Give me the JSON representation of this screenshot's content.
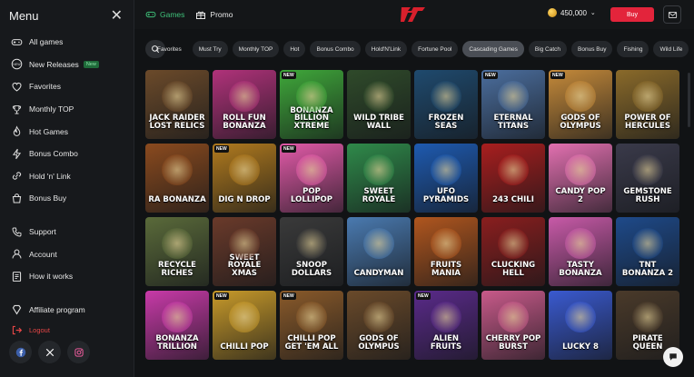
{
  "sidebar": {
    "title": "Menu",
    "items": [
      {
        "label": "All games",
        "icon": "controller-icon"
      },
      {
        "label": "New Releases",
        "icon": "new-icon",
        "badge": "New"
      },
      {
        "label": "Favorites",
        "icon": "heart-icon"
      },
      {
        "label": "Monthly TOP",
        "icon": "trophy-icon"
      },
      {
        "label": "Hot Games",
        "icon": "flame-icon"
      },
      {
        "label": "Bonus Combo",
        "icon": "lightning-icon"
      },
      {
        "label": "Hold 'n' Link",
        "icon": "link-icon"
      },
      {
        "label": "Bonus Buy",
        "icon": "bag-icon"
      }
    ],
    "support_items": [
      {
        "label": "Support",
        "icon": "phone-icon"
      },
      {
        "label": "Account",
        "icon": "user-icon"
      },
      {
        "label": "How it works",
        "icon": "document-icon"
      }
    ],
    "affiliate": {
      "label": "Affiliate program",
      "icon": "diamond-icon"
    },
    "logout": {
      "label": "Logout",
      "icon": "logout-icon"
    },
    "social": [
      "facebook-icon",
      "x-icon",
      "instagram-icon"
    ]
  },
  "topbar": {
    "nav": [
      {
        "label": "Games",
        "icon": "controller-icon",
        "active": true
      },
      {
        "label": "Promo",
        "icon": "gift-icon",
        "active": false
      }
    ],
    "balance": "450,000",
    "buy_label": "Buy",
    "accent": "#3fc27a",
    "buy_color": "#e3243b"
  },
  "categories": [
    "Favorites",
    "Must Try",
    "Monthly TOP",
    "Hot",
    "Bonus Combo",
    "Hold'N'Link",
    "Fortune Pool",
    "Cascading Games",
    "Big Catch",
    "Bonus Buy",
    "Fishing",
    "Wild Life"
  ],
  "active_category": "Cascading Games",
  "games": [
    {
      "title": "Jack Raider Lost Relics",
      "new": false,
      "bg": "#6b4a2a"
    },
    {
      "title": "Roll Fun Bonanza",
      "new": false,
      "bg": "#b0327a"
    },
    {
      "title": "Bonanza Billion Xtreme",
      "new": true,
      "bg": "#3fa83a"
    },
    {
      "title": "Wild Tribe Wall",
      "new": false,
      "bg": "#2f4a2a"
    },
    {
      "title": "Frozen Seas",
      "new": false,
      "bg": "#1f4a6e"
    },
    {
      "title": "Eternal Titans",
      "new": true,
      "bg": "#4b6e9e"
    },
    {
      "title": "Gods of Olympus",
      "new": true,
      "bg": "#c58a3a"
    },
    {
      "title": "Power of Hercules",
      "new": false,
      "bg": "#8a6a2a"
    },
    {
      "title": "Ra Bonanza",
      "new": false,
      "bg": "#8a4a1e"
    },
    {
      "title": "Dig N Drop",
      "new": true,
      "bg": "#b07a1e"
    },
    {
      "title": "Pop Lollipop",
      "new": true,
      "bg": "#e25aa8"
    },
    {
      "title": "Sweet Royale",
      "new": false,
      "bg": "#2f8a4a"
    },
    {
      "title": "UFO Pyramids",
      "new": false,
      "bg": "#1e5ab0"
    },
    {
      "title": "243 Chili",
      "new": false,
      "bg": "#a81e1e"
    },
    {
      "title": "Candy Pop 2",
      "new": false,
      "bg": "#e270b0"
    },
    {
      "title": "Gemstone Rush",
      "new": false,
      "bg": "#3a3a4a"
    },
    {
      "title": "Recycle Riches",
      "new": false,
      "bg": "#5a6a3a"
    },
    {
      "title": "Sweet Royale Xmas",
      "new": false,
      "bg": "#6a3a2a"
    },
    {
      "title": "Snoop Dollars",
      "new": false,
      "bg": "#3a3a3a"
    },
    {
      "title": "Candyman",
      "new": false,
      "bg": "#4a7ab0"
    },
    {
      "title": "Fruits Mania",
      "new": false,
      "bg": "#b0561e"
    },
    {
      "title": "Clucking Hell",
      "new": false,
      "bg": "#8a1e1e"
    },
    {
      "title": "Tasty Bonanza",
      "new": false,
      "bg": "#c85aa8"
    },
    {
      "title": "TNT Bonanza 2",
      "new": false,
      "bg": "#1e4a8a"
    },
    {
      "title": "Bonanza Trillion",
      "new": false,
      "bg": "#c83aa8"
    },
    {
      "title": "Chilli Pop",
      "new": true,
      "bg": "#c89a2a"
    },
    {
      "title": "Chilli Pop Get 'Em All",
      "new": true,
      "bg": "#8a5a2a"
    },
    {
      "title": "Gods of Olympus",
      "new": false,
      "bg": "#6a4a2a"
    },
    {
      "title": "Alien Fruits",
      "new": true,
      "bg": "#5a2a8a"
    },
    {
      "title": "Cherry Pop Burst",
      "new": false,
      "bg": "#c85a8a"
    },
    {
      "title": "Lucky 8",
      "new": false,
      "bg": "#3a5ad0"
    },
    {
      "title": "Pirate Queen",
      "new": false,
      "bg": "#4a3a2a"
    }
  ],
  "chat_icon": "chat-icon"
}
